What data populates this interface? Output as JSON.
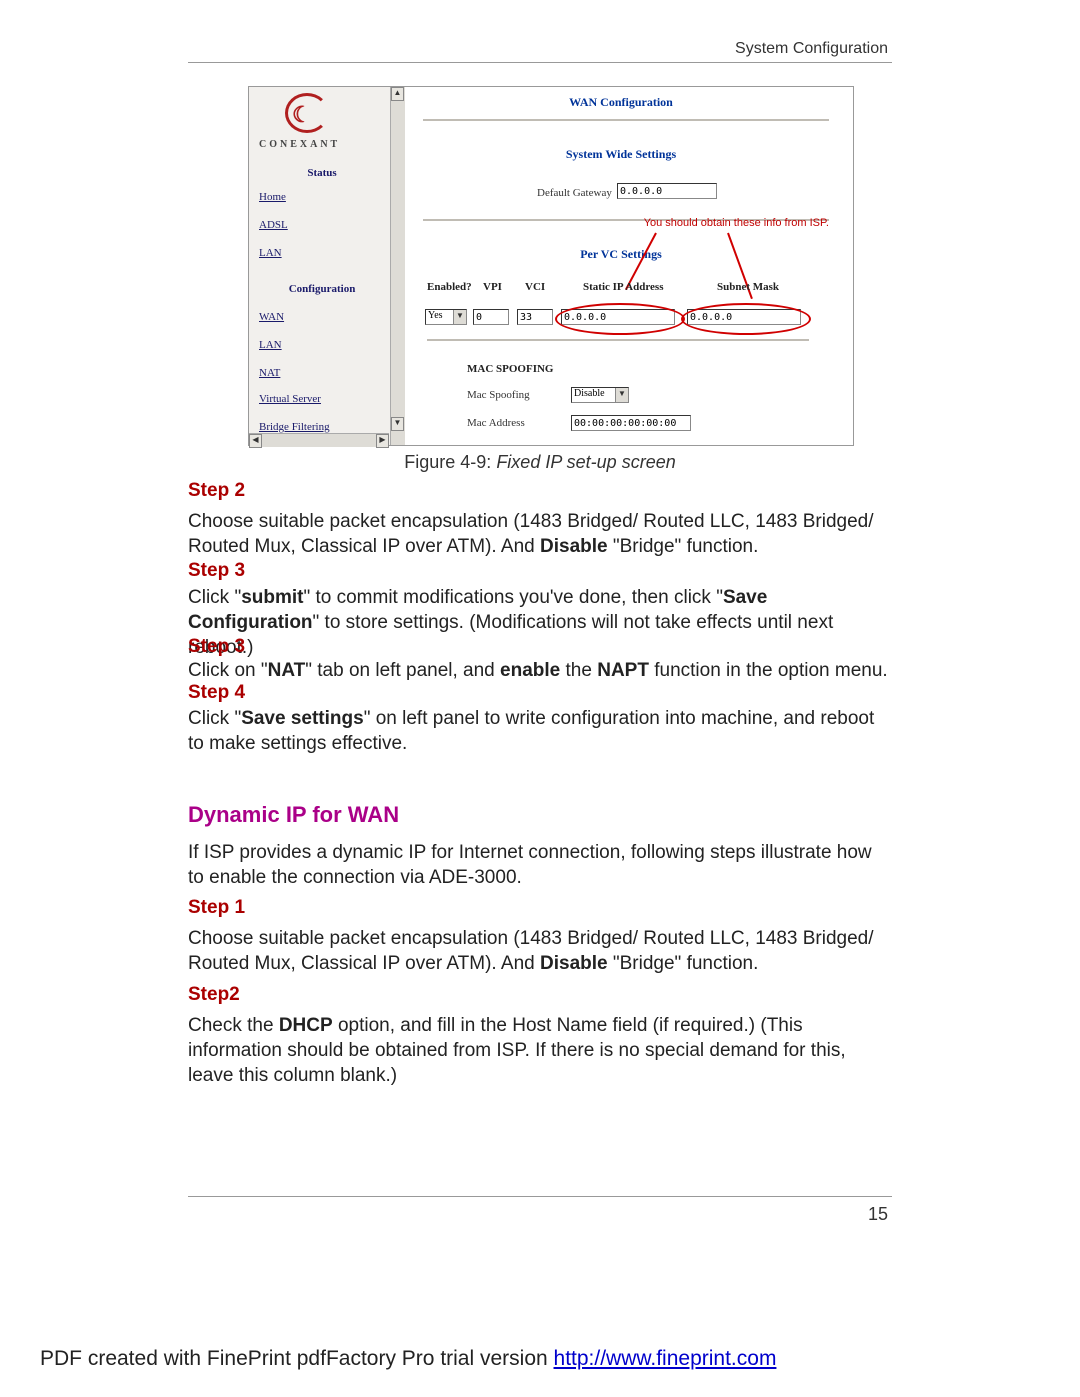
{
  "header": {
    "right": "System Configuration"
  },
  "screenshot": {
    "brand": "CONEXANT",
    "sections": {
      "status": "Status",
      "configuration": "Configuration"
    },
    "links": {
      "home": "Home",
      "adsl": "ADSL",
      "lan1": "LAN",
      "wan": "WAN",
      "lan2": "LAN",
      "nat": "NAT",
      "virtual_server": "Virtual Server",
      "bridge_filtering": "Bridge Filtering"
    },
    "titles": {
      "wan_config": "WAN Configuration",
      "system_wide": "System Wide Settings",
      "per_vc": "Per VC Settings",
      "mac_spoofing": "MAC SPOOFING"
    },
    "labels": {
      "default_gateway": "Default Gateway",
      "mac_spoofing": "Mac Spoofing",
      "mac_address": "Mac Address"
    },
    "note": "You should obtain these info from ISP.",
    "cols": {
      "enabled": "Enabled?",
      "vpi": "VPI",
      "vci": "VCI",
      "static_ip": "Static IP Address",
      "subnet": "Subnet Mask"
    },
    "values": {
      "default_gateway": "0.0.0.0",
      "enabled": "Yes",
      "vpi": "0",
      "vci": "33",
      "static_ip": "0.0.0.0",
      "subnet": "0.0.0.0",
      "mac_spoofing": "Disable",
      "mac_address": "00:00:00:00:00:00"
    }
  },
  "caption": {
    "prefix": "Figure 4-9: ",
    "text": "Fixed IP set-up screen"
  },
  "steps": {
    "s2a": "Step 2",
    "s3a": "Step 3",
    "s3b": "Step 3",
    "s4": "Step 4",
    "s1": "Step 1",
    "s2b": "Step2"
  },
  "body": {
    "p1a": "Choose suitable packet encapsulation (1483 Bridged/ Routed LLC, 1483 Bridged/ Routed Mux, Classical IP over ATM). And ",
    "p1b": "Disable",
    "p1c": " \"Bridge\" function.",
    "p2a": "Click \"",
    "p2b": "submit",
    "p2c": "\" to commit modifications you've done, then click \"",
    "p2d": "Save Configuration",
    "p2e": "\" to store settings. (Modifications will not take effects until next reboot.)",
    "p3a": "Click on \"",
    "p3b": "NAT",
    "p3c": "\" tab on left panel, and ",
    "p3d": "enable",
    "p3e": " the ",
    "p3f": "NAPT",
    "p3g": " function in the option menu.",
    "p4a": "Click \"",
    "p4b": "Save settings",
    "p4c": "\" on left panel to write configuration into machine, and reboot to make settings effective.",
    "dyn": "If ISP provides a dynamic IP for Internet connection, following steps illustrate how to enable the connection via ADE-3000.",
    "p5a": "Choose suitable packet encapsulation (1483 Bridged/ Routed LLC, 1483 Bridged/ Routed Mux, Classical IP over ATM). And ",
    "p5b": "Disable",
    "p5c": " \"Bridge\" function.",
    "p6a": "Check the ",
    "p6b": "DHCP",
    "p6c": " option, and fill in the Host Name field (if required.) (This information should be obtained from ISP. If there is no special demand for this, leave this column blank.)"
  },
  "section": {
    "dynamic": "Dynamic IP for WAN"
  },
  "page_num": "15",
  "footer": {
    "text": "PDF created with FinePrint pdfFactory Pro trial version ",
    "link": "http://www.fineprint.com"
  }
}
